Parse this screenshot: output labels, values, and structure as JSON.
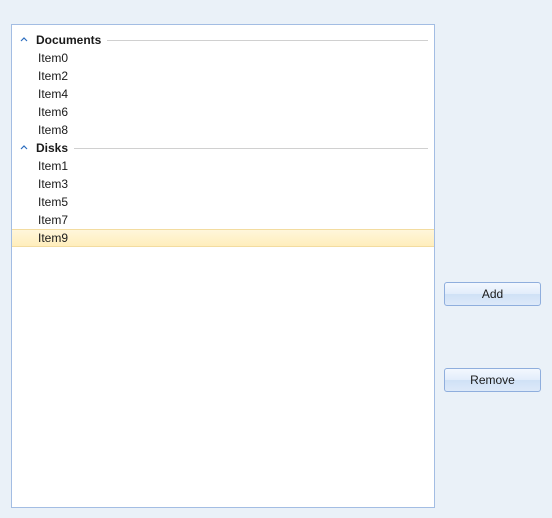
{
  "groups": [
    {
      "title": "Documents",
      "expanded": true,
      "items": [
        "Item0",
        "Item2",
        "Item4",
        "Item6",
        "Item8"
      ]
    },
    {
      "title": "Disks",
      "expanded": true,
      "items": [
        "Item1",
        "Item3",
        "Item5",
        "Item7",
        "Item9"
      ]
    }
  ],
  "selected_item": "Item9",
  "buttons": {
    "add_label": "Add",
    "remove_label": "Remove"
  }
}
